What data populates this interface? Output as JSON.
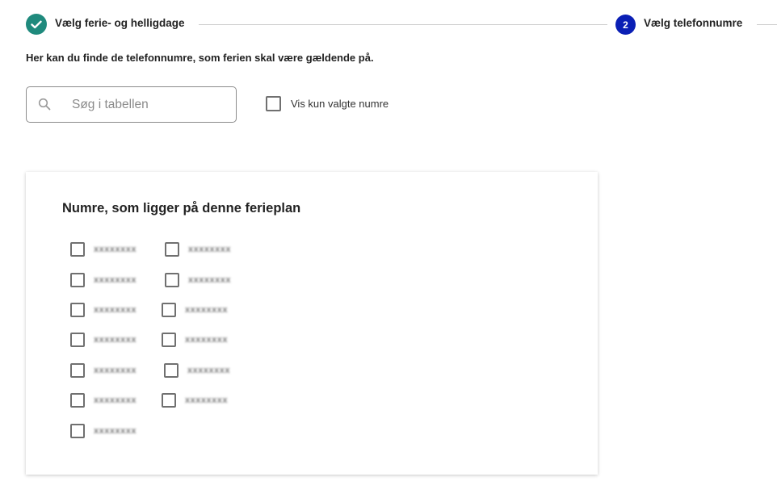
{
  "stepper": {
    "step1": {
      "label": "Vælg ferie- og helligdage",
      "status": "done",
      "icon": "check-icon"
    },
    "step2": {
      "number": "2",
      "label": "Vælg telefonnumre",
      "status": "active"
    },
    "colors": {
      "done": "#1f8a7d",
      "active": "#0a1fb5"
    }
  },
  "intro": "Her kan du finde de telefonnumre, som ferien skal være gældende på.",
  "search": {
    "placeholder": "Søg i tabellen",
    "value": "",
    "icon": "search-icon"
  },
  "filter": {
    "label": "Vis kun valgte numre",
    "checked": false
  },
  "card": {
    "title": "Numre, som ligger på denne ferieplan",
    "numbers": [
      {
        "value": "xxxxxxxx",
        "checked": false
      },
      {
        "value": "xxxxxxxx",
        "checked": false
      },
      {
        "value": "xxxxxxxx",
        "checked": false
      },
      {
        "value": "xxxxxxxx",
        "checked": false
      },
      {
        "value": "xxxxxxxx",
        "checked": false
      },
      {
        "value": "xxxxxxxx",
        "checked": false
      },
      {
        "value": "xxxxxxxx",
        "checked": false
      },
      {
        "value": "xxxxxxxx",
        "checked": false
      },
      {
        "value": "xxxxxxxx",
        "checked": false
      },
      {
        "value": "xxxxxxxx",
        "checked": false
      },
      {
        "value": "xxxxxxxx",
        "checked": false
      },
      {
        "value": "xxxxxxxx",
        "checked": false
      },
      {
        "value": "xxxxxxxx",
        "checked": false
      }
    ]
  }
}
